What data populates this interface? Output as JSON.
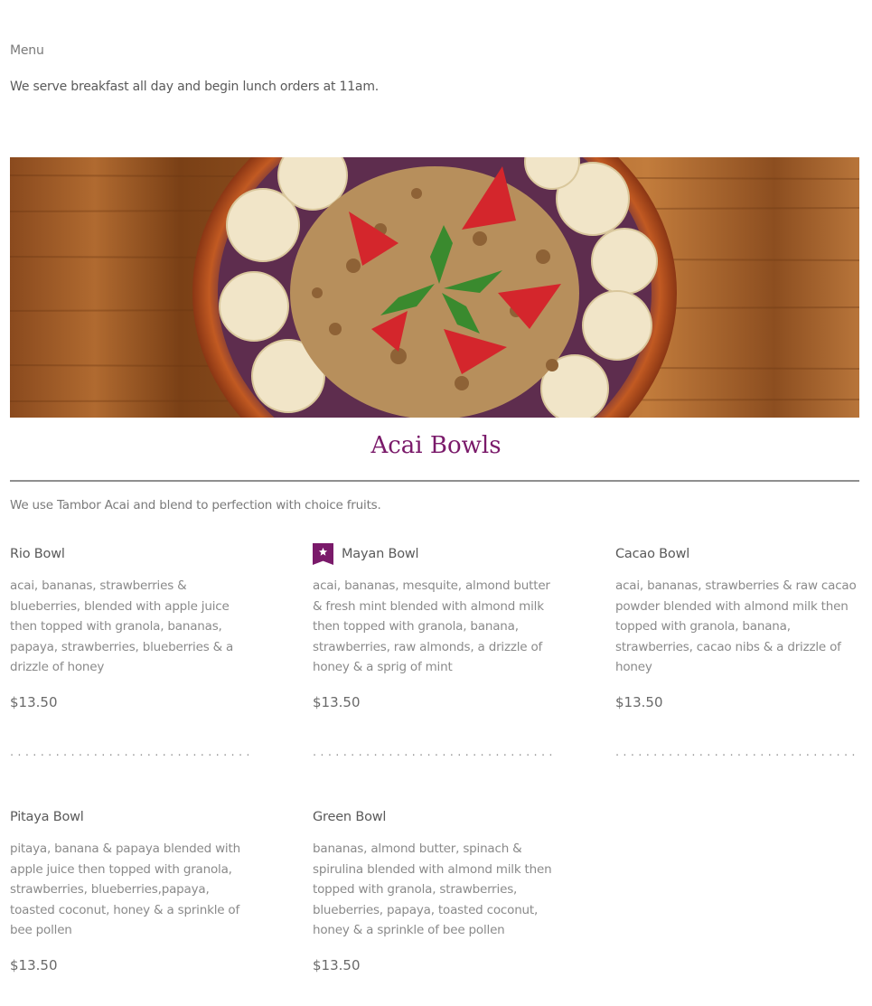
{
  "page": {
    "menu_label": "Menu",
    "intro": "We serve breakfast all day and begin lunch orders at 11am."
  },
  "hero": {
    "image": "acai-bowl-photo"
  },
  "section": {
    "title": "Acai Bowls",
    "subtitle": "We use Tambor Acai and blend to perfection with choice fruits.",
    "accent_color": "#7a1a6a"
  },
  "items": [
    {
      "name": "Rio Bowl",
      "desc": "acai, bananas, strawberries & blueberries, blended with apple juice then topped with granola, bananas, papaya, strawberries, blueberries & a drizzle of honey",
      "price": "$13.50"
    },
    {
      "name": "Mayan Bowl",
      "featured_icon": "star-ribbon-icon",
      "desc": "acai, bananas, mesquite, almond butter & fresh mint blended with almond milk then topped with granola, banana, strawberries, raw almonds, a drizzle of honey & a sprig of mint",
      "price": "$13.50"
    },
    {
      "name": "Cacao Bowl",
      "desc": "acai, bananas, strawberries & raw cacao powder blended with almond milk then topped with granola, banana, strawberries, cacao nibs & a drizzle of honey",
      "price": "$13.50"
    },
    {
      "name": "Pitaya Bowl",
      "desc": "pitaya, banana & papaya blended with apple juice then topped with granola, strawberries, blueberries,papaya, toasted coconut, honey & a sprinkle of bee pollen",
      "price": "$13.50"
    },
    {
      "name": "Green Bowl",
      "desc": "bananas, almond butter, spinach & spirulina blended with almond milk then topped with granola, strawberries, blueberries, papaya, toasted coconut, honey & a sprinkle of bee pollen",
      "price": "$13.50"
    }
  ]
}
